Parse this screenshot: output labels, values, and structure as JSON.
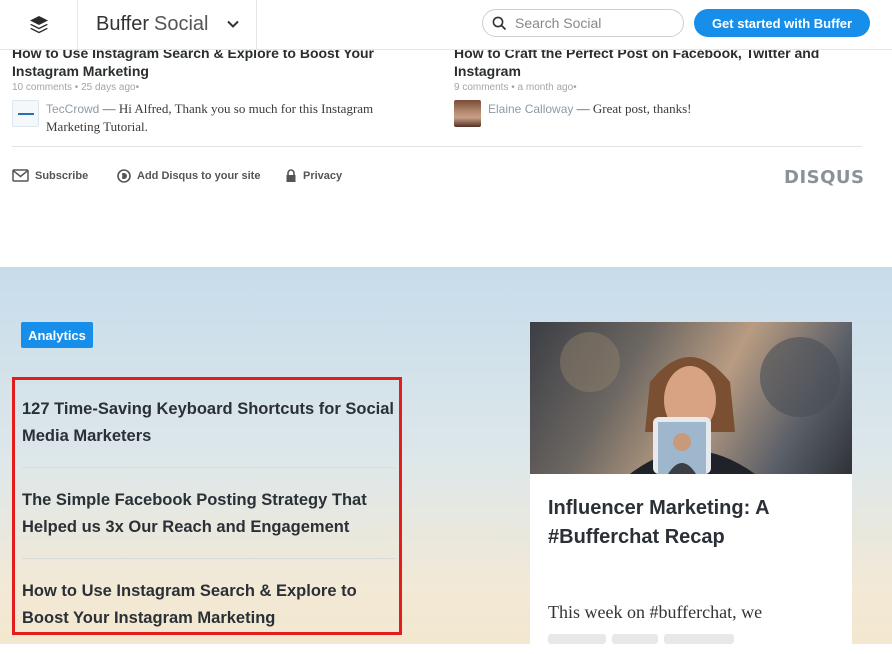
{
  "header": {
    "brand_strong": "Buffer",
    "brand_light": "Social",
    "search_placeholder": "Search Social",
    "cta_label": "Get started with Buffer"
  },
  "recent_posts": [
    {
      "title": "How to Use Instagram Search & Explore to Boost Your Instagram Marketing",
      "comments": "10 comments",
      "age": "25 days ago",
      "author": "TecCrowd",
      "comment": "— Hi Alfred, Thank you so much for this Instagram Marketing Tutorial."
    },
    {
      "title": "How to Craft the Perfect Post on Facebook, Twitter and Instagram",
      "comments": "9 comments",
      "age": "a month ago",
      "author": "Elaine Calloway",
      "comment": "— Great post, thanks!"
    }
  ],
  "disqus_footer": {
    "subscribe": "Subscribe",
    "add": "Add Disqus to your site",
    "privacy": "Privacy",
    "logo": "DISQUS"
  },
  "section": {
    "tag": "Analytics",
    "articles": [
      "127 Time-Saving Keyboard Shortcuts for Social Media Marketers",
      "The Simple Facebook Posting Strategy That Helped us 3x Our Reach and Engagement",
      "How to Use Instagram Search & Explore to Boost Your Instagram Marketing"
    ],
    "featured": {
      "title": "Influencer Marketing: A #Bufferchat Recap",
      "excerpt": "This week on #bufferchat, we"
    }
  },
  "colors": {
    "accent": "#168eea",
    "highlight_border": "#e31c1c"
  }
}
